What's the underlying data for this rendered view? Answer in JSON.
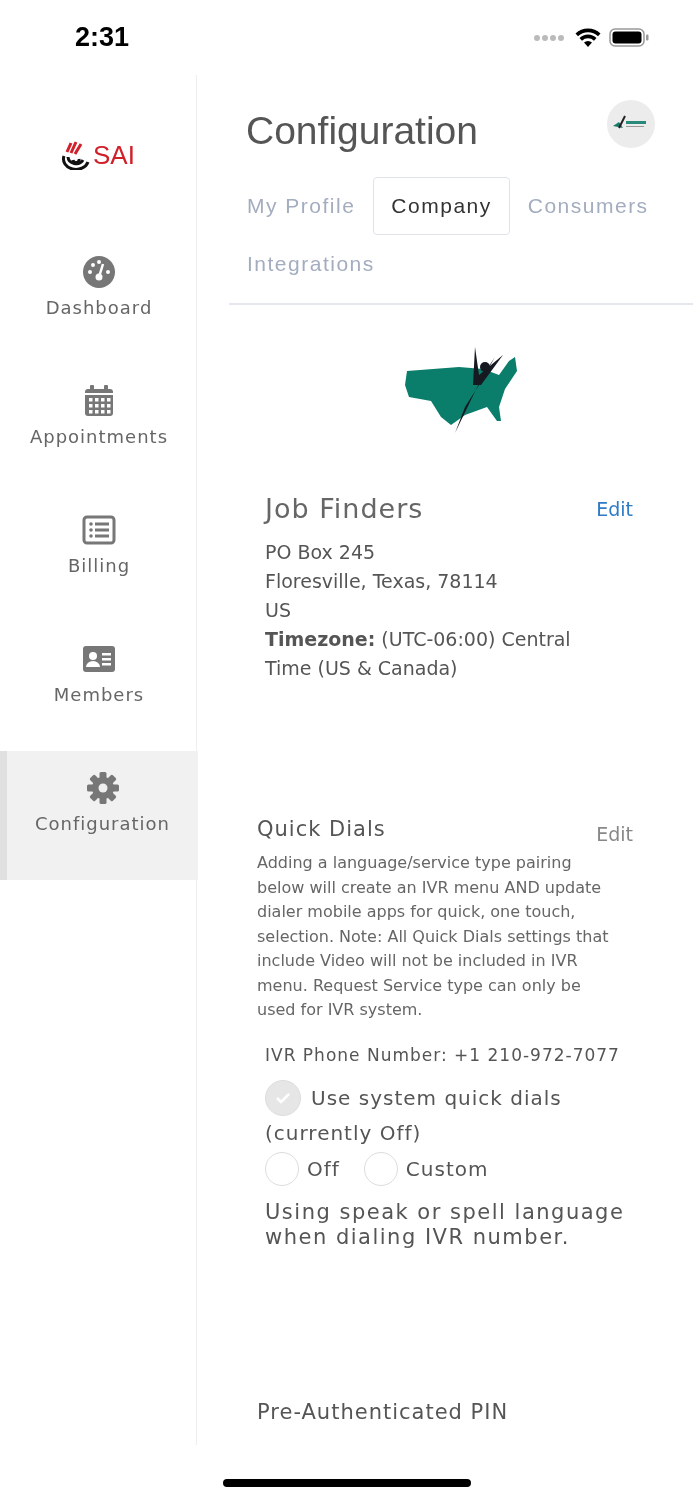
{
  "status_bar": {
    "time": "2:31"
  },
  "sidebar": {
    "logo": "SAI",
    "items": [
      {
        "label": "Dashboard",
        "kind": "dashboard",
        "selected": false
      },
      {
        "label": "Appointments",
        "kind": "calendar",
        "selected": false
      },
      {
        "label": "Billing",
        "kind": "list",
        "selected": false
      },
      {
        "label": "Members",
        "kind": "card",
        "selected": false
      },
      {
        "label": "Configuration",
        "kind": "gear",
        "selected": true
      }
    ]
  },
  "page": {
    "title": "Configuration"
  },
  "tabs": [
    {
      "label": "My Profile",
      "selected": false
    },
    {
      "label": "Company",
      "selected": true
    },
    {
      "label": "Consumers",
      "selected": false
    },
    {
      "label": "Integrations",
      "selected": false
    }
  ],
  "company": {
    "name": "Job Finders",
    "edit": "Edit",
    "address_lines": [
      "PO Box 245",
      "Floresville, Texas, 78114",
      "US"
    ],
    "timezone": "**Timezone:** (UTC-06:00) Central Time (US & Canada)"
  },
  "quick_dials": {
    "title": "Quick Dials",
    "edit": "Edit",
    "description": "Adding a language/service type pairing below will create an IVR menu AND update dialer mobile apps for quick, one touch, selection. Note: All Quick Dials settings that include Video will not be included in IVR menu. Request Service type can only be used for IVR system.",
    "ivr_phone": "IVR Phone Number: +1 210-972-7077",
    "use_system": {
      "label": "Use system quick dials",
      "status": "(currently Off)",
      "checked": true
    },
    "options": [
      {
        "label": "Off",
        "selected": false
      },
      {
        "label": "Custom",
        "selected": false
      }
    ],
    "note": "Using speak or spell language when dialing IVR number."
  },
  "pin_section": {
    "title": "Pre-Authenticated PIN"
  }
}
